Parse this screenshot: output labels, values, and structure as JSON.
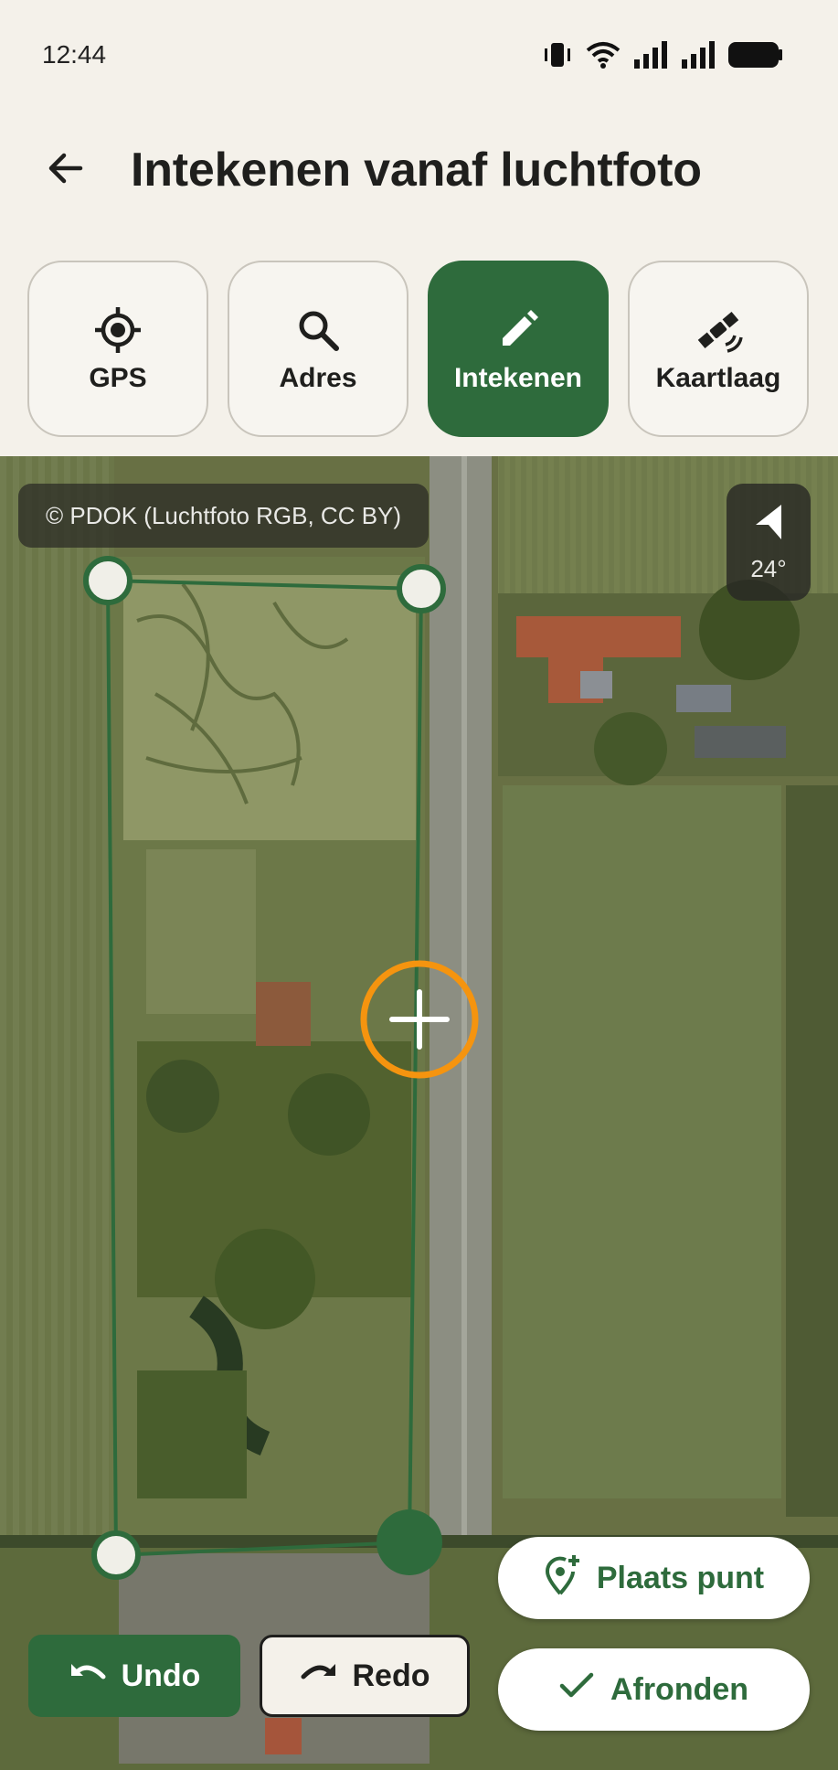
{
  "status_bar": {
    "time": "12:44",
    "icons": [
      "vibrate-icon",
      "wifi-icon",
      "signal-icon",
      "signal-icon",
      "battery-icon"
    ]
  },
  "app_bar": {
    "back_icon": "arrow-back-icon",
    "title": "Intekenen vanaf luchtfoto"
  },
  "tabs": [
    {
      "label": "GPS",
      "icon": "gps-target-icon",
      "active": false
    },
    {
      "label": "Adres",
      "icon": "search-icon",
      "active": false
    },
    {
      "label": "Intekenen",
      "icon": "pencil-icon",
      "active": true
    },
    {
      "label": "Kaartlaag",
      "icon": "satellite-icon",
      "active": false
    }
  ],
  "map": {
    "attribution": "© PDOK (Luchtfoto RGB, CC BY)",
    "compass": {
      "icon": "navigation-arrow-icon",
      "bearing": "24°"
    },
    "polygon_color": "#2e6b3c",
    "crosshair_color": "#f5940f"
  },
  "actions": {
    "undo": "Undo",
    "redo": "Redo",
    "place_point": "Plaats punt",
    "finish": "Afronden"
  },
  "colors": {
    "accent": "#2e6b3c",
    "background": "#f4f1ea",
    "crosshair": "#f5940f"
  }
}
